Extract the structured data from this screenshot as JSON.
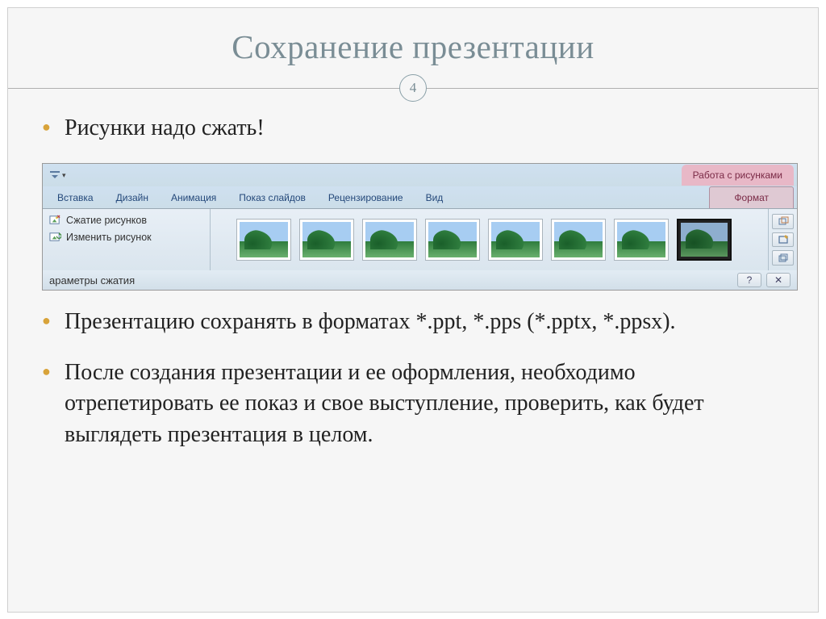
{
  "slide": {
    "title": "Сохранение презентации",
    "number": "4"
  },
  "bullets": {
    "b1": "Рисунки надо сжать!",
    "b2": "Презентацию сохранять в форматах *.ppt, *.pps (*.pptx, *.ppsx).",
    "b3": "После создания презентации и ее оформления, необходимо отрепетировать ее показ и свое выступление, проверить, как будет выглядеть презентация в целом."
  },
  "ribbon": {
    "context_tab_title": "Работа с рисунками",
    "tabs": {
      "insert": "Вставка",
      "design": "Дизайн",
      "animation": "Анимация",
      "slideshow": "Показ слайдов",
      "review": "Рецензирование",
      "view": "Вид",
      "format": "Формат"
    },
    "adjust": {
      "compress": "Сжатие рисунков",
      "change": "Изменить рисунок"
    },
    "status_label": "араметры сжатия",
    "help_symbol": "?",
    "close_symbol": "✕"
  }
}
